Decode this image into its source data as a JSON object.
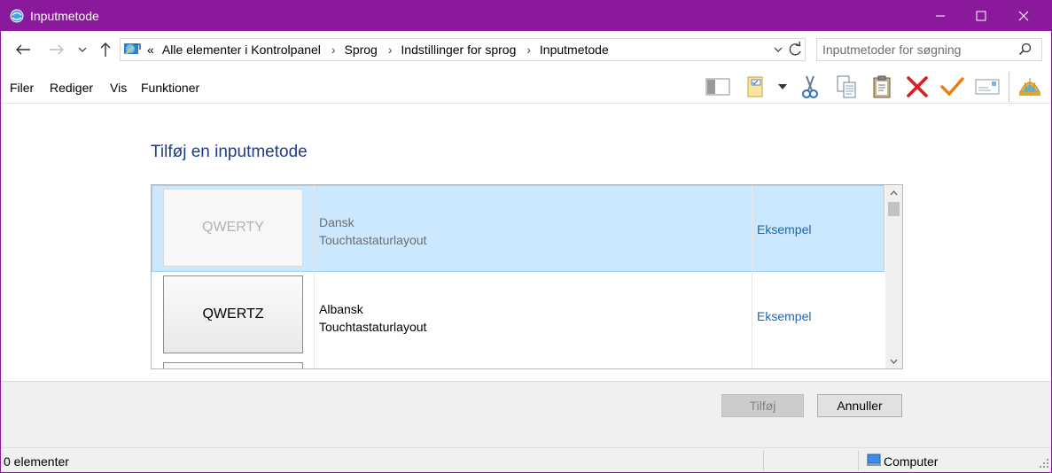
{
  "window": {
    "title": "Inputmetode",
    "accent_color": "#8a1a9b"
  },
  "address": {
    "overflow": "«",
    "crumbs": [
      "Alle elementer i Kontrolpanel",
      "Sprog",
      "Indstillinger for sprog",
      "Inputmetode"
    ]
  },
  "search": {
    "placeholder": "Inputmetoder for søgning"
  },
  "menu": {
    "file": "Filer",
    "edit": "Rediger",
    "view": "Vis",
    "tools": "Funktioner"
  },
  "toolbar_icons": [
    "layout-pane-icon",
    "folder-properties-icon",
    "cut-icon",
    "copy-icon",
    "paste-icon",
    "delete-icon",
    "check-icon",
    "email-icon",
    "shell-icon"
  ],
  "content": {
    "heading": "Tilføj en inputmetode",
    "rows": [
      {
        "keyboard": "QWERTY",
        "language": "Dansk",
        "layout": "Touchtastaturlayout",
        "example": "Eksempel",
        "selected": true
      },
      {
        "keyboard": "QWERTZ",
        "language": "Albansk",
        "layout": "Touchtastaturlayout",
        "example": "Eksempel",
        "selected": false
      }
    ]
  },
  "buttons": {
    "add": "Tilføj",
    "cancel": "Annuller"
  },
  "status": {
    "count": "0 elementer",
    "zone": "Computer"
  },
  "colors": {
    "selected_row": "#cce8ff",
    "heading": "#1e3c8c",
    "link": "#1a66b3"
  }
}
